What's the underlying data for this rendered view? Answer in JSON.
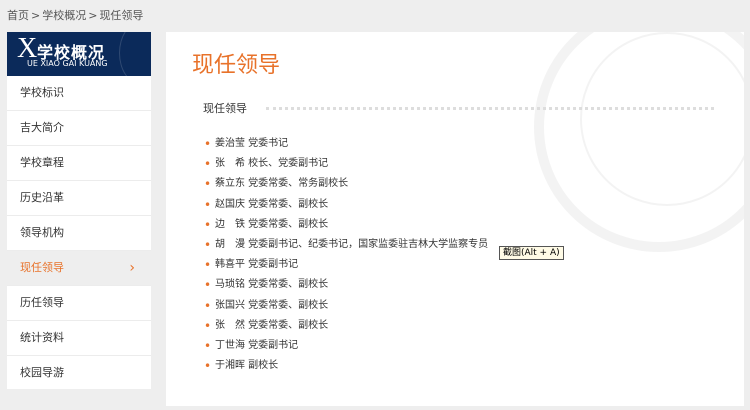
{
  "breadcrumb": {
    "items": [
      "首页",
      "学校概况",
      "现任领导"
    ],
    "separator": ">"
  },
  "sidebar": {
    "header": {
      "letter": "X",
      "title": "学校概况",
      "subtitle": "UE XIAO GAI KUANG"
    },
    "items": [
      {
        "label": "学校标识"
      },
      {
        "label": "吉大简介"
      },
      {
        "label": "学校章程"
      },
      {
        "label": "历史沿革"
      },
      {
        "label": "领导机构"
      },
      {
        "label": "现任领导",
        "active": true
      },
      {
        "label": "历任领导"
      },
      {
        "label": "统计资料"
      },
      {
        "label": "校园导游"
      }
    ],
    "active_icon": "chevron-right-icon"
  },
  "main": {
    "title": "现任领导",
    "section_title": "现任领导",
    "leaders": [
      "姜治莹 党委书记",
      "张　希 校长、党委副书记",
      "蔡立东 党委常委、常务副校长",
      "赵国庆 党委常委、副校长",
      "边　铁 党委常委、副校长",
      "胡　漫 党委副书记、纪委书记，国家监委驻吉林大学监察专员",
      "韩喜平 党委副书记",
      "马琐铭 党委常委、副校长",
      "张国兴 党委常委、副校长",
      "张　然 党委常委、副校长",
      "丁世海 党委副书记",
      "于湘晖 副校长"
    ]
  },
  "tooltip": {
    "text": "截图(Alt + A)"
  },
  "colors": {
    "accent": "#e8722a",
    "sidebar_header_bg": "#0b2a5a",
    "page_bg": "#eeeeee"
  }
}
